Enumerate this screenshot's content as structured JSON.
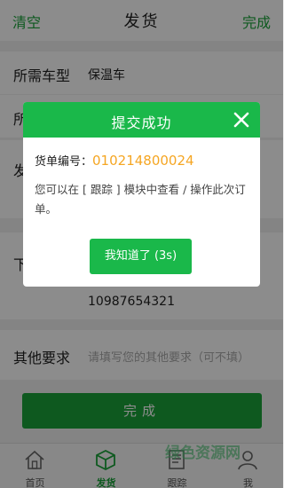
{
  "header": {
    "left_label": "清空",
    "title": "发货",
    "right_label": "完成"
  },
  "form": {
    "vehicle_type": {
      "label": "所需车型",
      "value": "保温车"
    },
    "row2_label": "所",
    "row3_label": "发",
    "row4_label": "下",
    "phone_value": "10987654321",
    "other": {
      "label": "其他要求",
      "placeholder": "请填写您的其他要求（可不填）"
    },
    "submit_label": "完成"
  },
  "tabbar": {
    "tabs": [
      {
        "label": "首页",
        "icon": "home-icon",
        "active": false
      },
      {
        "label": "发货",
        "icon": "box-icon",
        "active": true
      },
      {
        "label": "跟踪",
        "icon": "tracking-icon",
        "active": false
      },
      {
        "label": "我",
        "icon": "profile-icon",
        "active": false
      }
    ]
  },
  "dialog": {
    "title": "提交成功",
    "order_label": "货单编号：",
    "order_number": "010214800024",
    "message": "您可以在 [ 跟踪 ] 模块中查看 / 操作此次订单。",
    "button_label": "我知道了 (3s)"
  },
  "watermark": "绿色资源网",
  "colors": {
    "accent": "#1aa33a",
    "dialog_header": "#1ab84a",
    "order_number": "#f5a623"
  }
}
